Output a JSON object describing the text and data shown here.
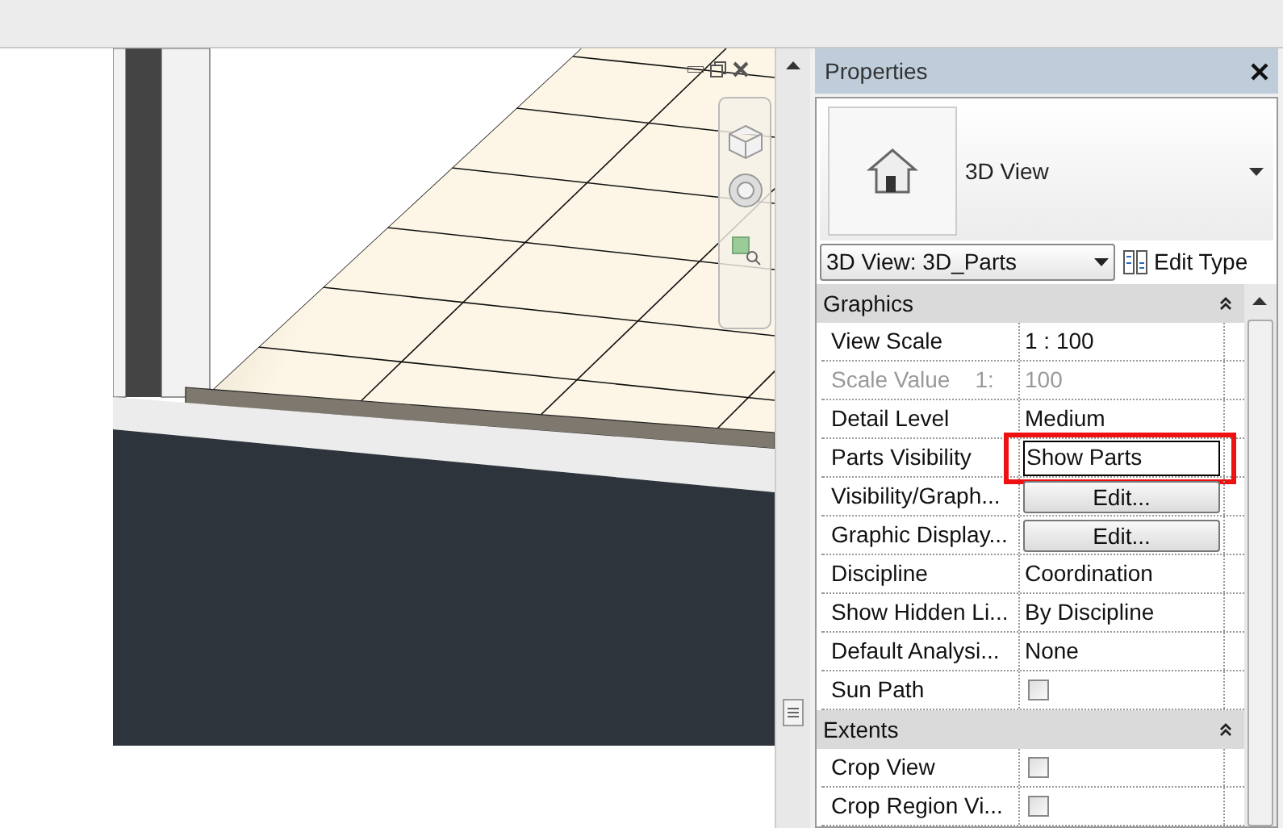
{
  "properties": {
    "title": "Properties",
    "type_name": "3D View",
    "instance": "3D View: 3D_Parts",
    "edit_type": "Edit Type",
    "groups": [
      {
        "name": "Graphics",
        "expanded": true,
        "rows": [
          {
            "label": "View Scale",
            "kind": "text",
            "value": "1 : 100",
            "disabled": false,
            "highlighted": false
          },
          {
            "label": "Scale Value    1:",
            "kind": "text",
            "value": "100",
            "disabled": true,
            "highlighted": false
          },
          {
            "label": "Detail Level",
            "kind": "text",
            "value": "Medium",
            "disabled": false,
            "highlighted": false
          },
          {
            "label": "Parts Visibility",
            "kind": "field",
            "value": "Show Parts",
            "disabled": false,
            "highlighted": true
          },
          {
            "label": "Visibility/Graph...",
            "kind": "button",
            "value": "Edit...",
            "disabled": false,
            "highlighted": false
          },
          {
            "label": "Graphic Display...",
            "kind": "button",
            "value": "Edit...",
            "disabled": false,
            "highlighted": false
          },
          {
            "label": "Discipline",
            "kind": "text",
            "value": "Coordination",
            "disabled": false,
            "highlighted": false
          },
          {
            "label": "Show Hidden Li...",
            "kind": "text",
            "value": "By Discipline",
            "disabled": false,
            "highlighted": false
          },
          {
            "label": "Default Analysi...",
            "kind": "text",
            "value": "None",
            "disabled": false,
            "highlighted": false
          },
          {
            "label": "Sun Path",
            "kind": "checkbox",
            "checked": false,
            "disabled": false,
            "highlighted": false
          }
        ]
      },
      {
        "name": "Extents",
        "expanded": true,
        "rows": [
          {
            "label": "Crop View",
            "kind": "checkbox",
            "checked": false,
            "disabled": false,
            "highlighted": false
          },
          {
            "label": "Crop Region Vi...",
            "kind": "checkbox",
            "checked": false,
            "disabled": false,
            "highlighted": false
          }
        ]
      }
    ]
  }
}
